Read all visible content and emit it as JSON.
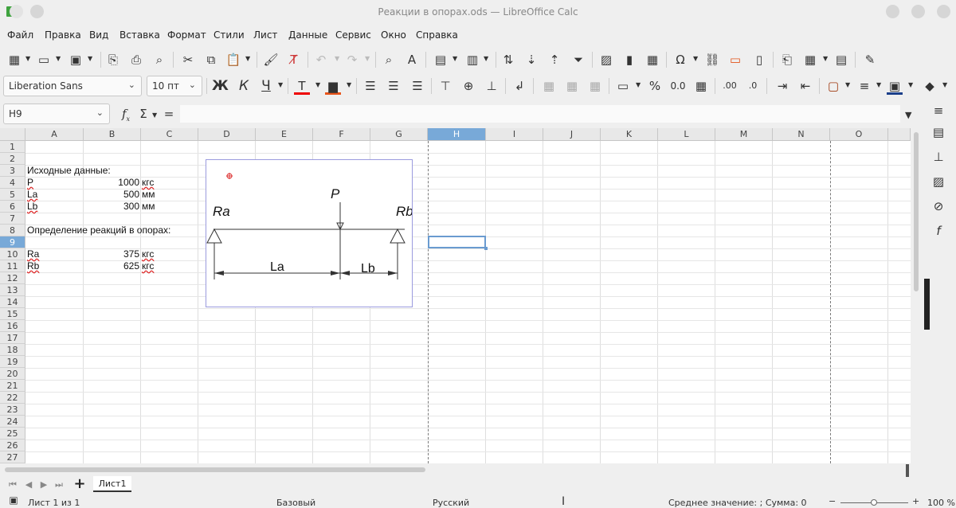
{
  "window": {
    "title": "Реакции в опорах.ods — LibreOffice Calc"
  },
  "menu": [
    "Файл",
    "Правка",
    "Вид",
    "Вставка",
    "Формат",
    "Стили",
    "Лист",
    "Данные",
    "Сервис",
    "Окно",
    "Справка"
  ],
  "format_bar": {
    "font_name": "Liberation Sans",
    "font_size": "10 пт"
  },
  "formula_bar": {
    "cell_ref": "H9",
    "fx": "f",
    "sum": "Σ",
    "equals": "=",
    "formula": ""
  },
  "columns": [
    "A",
    "B",
    "C",
    "D",
    "E",
    "F",
    "G",
    "H",
    "I",
    "J",
    "K",
    "L",
    "M",
    "N",
    "O"
  ],
  "selected_column": "H",
  "rows": [
    "1",
    "2",
    "3",
    "4",
    "5",
    "6",
    "7",
    "8",
    "9",
    "10",
    "11",
    "12",
    "13",
    "14",
    "15",
    "16",
    "17",
    "18",
    "19",
    "20",
    "21",
    "22",
    "23",
    "24",
    "25",
    "26",
    "27"
  ],
  "selected_row": "9",
  "cells": {
    "A3": "Исходные данные:",
    "A4": "P",
    "B4": "1000",
    "C4": "кгс",
    "A5": "La",
    "B5": "500",
    "C5": "мм",
    "A6": "Lb",
    "B6": "300",
    "C6": "мм",
    "A8": "Определение реакций в опорах:",
    "A10": "Ra",
    "B10": "375",
    "C10": "кгс",
    "A11": "Rb",
    "B11": "625",
    "C11": "кгс"
  },
  "drawing": {
    "label_ra": "Ra",
    "label_rb": "Rb",
    "label_p": "P",
    "label_la": "La",
    "label_lb": "Lb"
  },
  "sheet": {
    "tab": "Лист1",
    "add": "+"
  },
  "status": {
    "sheet_pos": "Лист 1 из 1",
    "style": "Базовый",
    "language": "Русский",
    "summary": "Среднее значение: ; Сумма: 0",
    "zoom": "100 %",
    "zoom_minus": "−",
    "zoom_plus": "+"
  },
  "icons": [
    "app-icon",
    "new-icon",
    "open-icon",
    "save-icon",
    "print-icon",
    "cut-icon",
    "copy-icon",
    "paste-icon",
    "undo-icon",
    "redo-icon",
    "find-icon",
    "sort-icon",
    "chart-icon",
    "omega-icon",
    "comment-icon",
    "bold-icon",
    "italic-icon",
    "underline-icon",
    "font-color-icon",
    "highlight-icon",
    "align-left-icon",
    "align-center-icon",
    "align-right-icon",
    "percent-icon",
    "sidebar-properties-icon",
    "sidebar-styles-icon",
    "sidebar-gallery-icon",
    "sidebar-navigator-icon",
    "sidebar-functions-icon"
  ]
}
